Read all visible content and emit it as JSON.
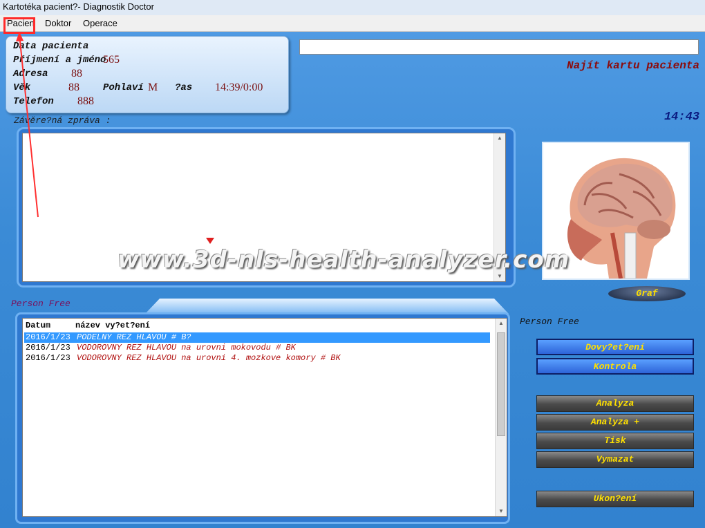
{
  "window": {
    "title": "Kartotéka pacient?- Diagnostik Doctor"
  },
  "menu": {
    "items": [
      "Pacien",
      "Doktor",
      "Operace"
    ]
  },
  "patient": {
    "header": "Data pacienta",
    "name_label": "Příjmení a jméno",
    "name_value": "565",
    "address_label": "Adresa",
    "address_value": "88",
    "age_label": "Věk",
    "age_value": "88",
    "sex_label": "Pohlaví",
    "sex_value": "M",
    "time_label": "?as",
    "time_value": "14:39/0:00",
    "phone_label": "Telefon",
    "phone_value": "888"
  },
  "search": {
    "value": "",
    "find_label": "Najít kartu pacienta"
  },
  "clock": "14:43",
  "report": {
    "label": "Závěre?ná zpráva :",
    "text": ""
  },
  "person_left": "Person Free",
  "person_right": "Person Free",
  "list": {
    "columns": [
      "Datum",
      "název vy?et?ení"
    ],
    "rows": [
      {
        "date": "2016/1/23",
        "name": "PODELNY REZ HLAVOU # B?",
        "selected": true
      },
      {
        "date": "2016/1/23",
        "name": "VODOROVNY REZ HLAVOU na urovni mokovodu # BK",
        "selected": false
      },
      {
        "date": "2016/1/23",
        "name": "VODOROVNY REZ HLAVOU na urovni 4. mozkove komory # BK",
        "selected": false
      }
    ]
  },
  "buttons": {
    "graf": "Graf",
    "vysetreni": "Dovy?et?ení",
    "kontrola": "Kontrola",
    "analyza": "Analyza",
    "analyza_plus": "Analyza +",
    "tisk": "Tisk",
    "vymazat": "Vymazat",
    "ukonceni": "Ukon?ení"
  },
  "watermark": "www.3d-nls-health-analyzer.com",
  "icons": [
    "scroll-up-icon",
    "scroll-down-icon",
    "brain-image"
  ]
}
